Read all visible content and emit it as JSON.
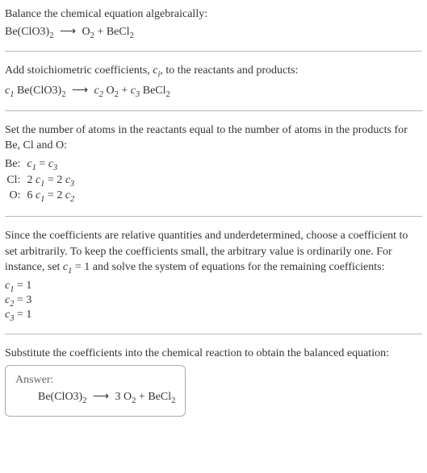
{
  "section1": {
    "intro": "Balance the chemical equation algebraically:",
    "eq_lhs": "Be(ClO3)",
    "eq_lhs_sub": "2",
    "arrow": "⟶",
    "eq_r1": "O",
    "eq_r1_sub": "2",
    "plus": " + ",
    "eq_r2": "BeCl",
    "eq_r2_sub": "2"
  },
  "section2": {
    "intro_a": "Add stoichiometric coefficients, ",
    "ci": "c",
    "ci_sub": "i",
    "intro_b": ", to the reactants and products:",
    "c1": "c",
    "c1_sub": "1",
    "sp1": " Be(ClO3)",
    "sp1_sub": "2",
    "arrow": "⟶",
    "c2": "c",
    "c2_sub": "2",
    "sp2": " O",
    "sp2_sub": "2",
    "plus": " + ",
    "c3": "c",
    "c3_sub": "3",
    "sp3": " BeCl",
    "sp3_sub": "2"
  },
  "section3": {
    "intro": "Set the number of atoms in the reactants equal to the number of atoms in the products for Be, Cl and O:",
    "rows": [
      {
        "label": "Be:",
        "lhs_c": "c",
        "lhs_sub": "1",
        "eq": " = ",
        "rhs_c": "c",
        "rhs_sub": "3",
        "lhs_coef": "",
        "rhs_coef": ""
      },
      {
        "label": "Cl:",
        "lhs_c": "c",
        "lhs_sub": "1",
        "eq": " = ",
        "rhs_c": "c",
        "rhs_sub": "3",
        "lhs_coef": "2 ",
        "rhs_coef": "2 "
      },
      {
        "label": "O:",
        "lhs_c": "c",
        "lhs_sub": "1",
        "eq": " = ",
        "rhs_c": "c",
        "rhs_sub": "2",
        "lhs_coef": "6 ",
        "rhs_coef": "2 "
      }
    ]
  },
  "section4": {
    "intro_a": "Since the coefficients are relative quantities and underdetermined, choose a coefficient to set arbitrarily. To keep the coefficients small, the arbitrary value is ordinarily one. For instance, set ",
    "c1": "c",
    "c1_sub": "1",
    "intro_b": " = 1 and solve the system of equations for the remaining coefficients:",
    "vals": [
      {
        "c": "c",
        "sub": "1",
        "val": " = 1"
      },
      {
        "c": "c",
        "sub": "2",
        "val": " = 3"
      },
      {
        "c": "c",
        "sub": "3",
        "val": " = 1"
      }
    ]
  },
  "section5": {
    "intro": "Substitute the coefficients into the chemical reaction to obtain the balanced equation:",
    "answer_label": "Answer:",
    "eq_lhs": "Be(ClO3)",
    "eq_lhs_sub": "2",
    "arrow": "⟶",
    "coef_o2": "3 ",
    "eq_r1": "O",
    "eq_r1_sub": "2",
    "plus": " + ",
    "eq_r2": "BeCl",
    "eq_r2_sub": "2"
  }
}
